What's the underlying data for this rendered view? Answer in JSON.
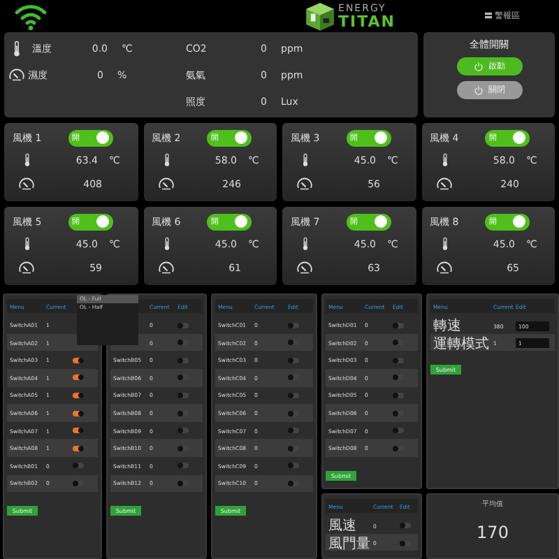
{
  "header": {
    "logo": {
      "top": "ENERGY",
      "bottom": "TITAN"
    },
    "alarm_link": "警報區"
  },
  "sensors": [
    {
      "kind": "temperature",
      "label": "溫度",
      "value": "0.0",
      "unit": "℃"
    },
    {
      "kind": "humidity",
      "label": "濕度",
      "value": "0",
      "unit": "%"
    },
    {
      "kind": "gas",
      "label": "CO2",
      "value": "0",
      "unit": "ppm"
    },
    {
      "kind": "gas",
      "label": "氨氣",
      "value": "0",
      "unit": "ppm"
    },
    {
      "kind": "gas",
      "label": "照度",
      "value": "0",
      "unit": "Lux"
    }
  ],
  "master_switch": {
    "title": "全體開關",
    "buttons": [
      {
        "label": "啟動",
        "selected": true
      },
      {
        "label": "關閉",
        "selected": false
      }
    ]
  },
  "fans": [
    {
      "name": "風機 1",
      "on": true,
      "switch_label": "開",
      "temperature": "63.4",
      "unit": "℃",
      "speed": "408"
    },
    {
      "name": "風機 2",
      "on": true,
      "switch_label": "開",
      "temperature": "58.0",
      "unit": "℃",
      "speed": "246"
    },
    {
      "name": "風機 3",
      "on": true,
      "switch_label": "開",
      "temperature": "45.0",
      "unit": "℃",
      "speed": "56"
    },
    {
      "name": "風機 4",
      "on": true,
      "switch_label": "開",
      "temperature": "58.0",
      "unit": "℃",
      "speed": "240"
    },
    {
      "name": "風機 5",
      "on": true,
      "switch_label": "開",
      "temperature": "45.0",
      "unit": "℃",
      "speed": "59"
    },
    {
      "name": "風機 6",
      "on": true,
      "switch_label": "開",
      "temperature": "45.0",
      "unit": "℃",
      "speed": "61"
    },
    {
      "name": "風機 7",
      "on": true,
      "switch_label": "開",
      "temperature": "45.0",
      "unit": "℃",
      "speed": "63"
    },
    {
      "name": "風機 8",
      "on": true,
      "switch_label": "開",
      "temperature": "45.0",
      "unit": "℃",
      "speed": "65"
    }
  ],
  "panels": [
    {
      "kind": "switch_table",
      "header": {
        "menu": "Menu",
        "current": "Current"
      },
      "submit": "Submit",
      "dropdown": {
        "items": [
          {
            "label": "OL - Full",
            "selected": true
          },
          {
            "label": "OL - Half",
            "selected": false
          }
        ]
      },
      "rows": [
        {
          "label": "SwitchA01",
          "current": "1"
        },
        {
          "label": "SwitchA02",
          "current": "1"
        },
        {
          "label": "SwitchA03",
          "current": "1",
          "on": true
        },
        {
          "label": "SwitchA04",
          "current": "1",
          "on": true
        },
        {
          "label": "SwitchA05",
          "current": "1",
          "on": true
        },
        {
          "label": "SwitchA06",
          "current": "1",
          "on": true
        },
        {
          "label": "SwitchA07",
          "current": "1",
          "on": true
        },
        {
          "label": "SwitchA08",
          "current": "1",
          "on": true
        },
        {
          "label": "SwitchB01",
          "current": "0",
          "on": false
        },
        {
          "label": "SwitchB02",
          "current": "0",
          "on": false
        }
      ]
    },
    {
      "kind": "switch_table",
      "header": {
        "current": "Current",
        "edit": "Edit"
      },
      "submit": "Submit",
      "rows": [
        {
          "current": "0",
          "on": false
        },
        {
          "current": "0",
          "on": false
        },
        {
          "label": "SwitchB05",
          "current": "0",
          "on": false
        },
        {
          "label": "SwitchB06",
          "current": "0",
          "on": false
        },
        {
          "label": "SwitchB07",
          "current": "0",
          "on": false
        },
        {
          "label": "SwitchB08",
          "current": "0",
          "on": false
        },
        {
          "label": "SwitchB09",
          "current": "0",
          "on": false
        },
        {
          "label": "SwitchB10",
          "current": "0",
          "on": false
        },
        {
          "label": "SwitchB11",
          "current": "0",
          "on": false
        },
        {
          "label": "SwitchB12",
          "current": "0",
          "on": false
        }
      ]
    },
    {
      "kind": "switch_table",
      "header": {
        "menu": "Menu",
        "current": "Current",
        "edit": "Edit"
      },
      "submit": "Submit",
      "rows": [
        {
          "label": "SwitchC01",
          "current": "0",
          "on": false
        },
        {
          "label": "SwitchC02",
          "current": "0",
          "on": false
        },
        {
          "label": "SwitchC03",
          "current": "0",
          "on": false
        },
        {
          "label": "SwitchC04",
          "current": "0",
          "on": false
        },
        {
          "label": "SwitchC05",
          "current": "0",
          "on": false
        },
        {
          "label": "SwitchC06",
          "current": "0",
          "on": false
        },
        {
          "label": "SwitchC07",
          "current": "0",
          "on": false
        },
        {
          "label": "SwitchC08",
          "current": "0",
          "on": false
        },
        {
          "label": "SwitchC09",
          "current": "0",
          "on": false
        },
        {
          "label": "SwitchC10",
          "current": "0",
          "on": false
        }
      ]
    },
    {
      "kind": "switch_table",
      "header": {
        "menu": "Menu",
        "current": "Current",
        "edit": "Edit"
      },
      "submit": "Submit",
      "rows": [
        {
          "label": "SwitchD01",
          "current": "0",
          "on": false
        },
        {
          "label": "SwitchD02",
          "current": "0",
          "on": false
        },
        {
          "label": "SwitchD03",
          "current": "0",
          "on": false
        },
        {
          "label": "SwitchD04",
          "current": "0",
          "on": false
        },
        {
          "label": "SwitchD05",
          "current": "0",
          "on": false
        },
        {
          "label": "SwitchD06",
          "current": "0",
          "on": false
        },
        {
          "label": "SwitchD07",
          "current": "0",
          "on": false
        },
        {
          "label": "SwitchD08",
          "current": "0",
          "on": false
        }
      ]
    },
    {
      "kind": "switch_table",
      "header": {
        "menu": "Menu",
        "current": "Current",
        "edit": "Edit"
      },
      "rows": [
        {
          "label": "風速",
          "current": "0",
          "on": false
        },
        {
          "label": "風門量",
          "current": "0",
          "on": false
        }
      ]
    },
    {
      "kind": "input_table",
      "header": {
        "menu": "Menu",
        "current": "Current",
        "edit": "Edit"
      },
      "submit": "Submit",
      "rows": [
        {
          "label": "轉速",
          "current": "380",
          "value": "100"
        },
        {
          "label": "運轉模式",
          "current": "1",
          "value": "1"
        }
      ]
    },
    {
      "kind": "reading",
      "title": "平均值",
      "value": "170"
    }
  ]
}
